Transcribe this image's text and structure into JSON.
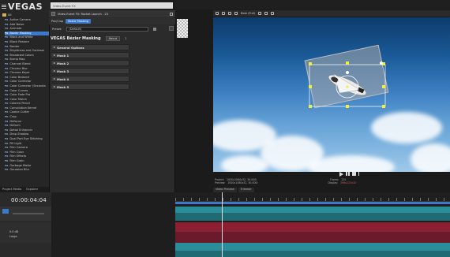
{
  "app": {
    "logo": "VEGAS"
  },
  "fx_list": {
    "items": [
      {
        "tag": "FX",
        "label": "Active Camera"
      },
      {
        "tag": "FX",
        "label": "Add Noise"
      },
      {
        "tag": "FX",
        "label": "Animate"
      },
      {
        "tag": "FX",
        "label": "Bezier Masking"
      },
      {
        "tag": "FX",
        "label": "Black and White"
      },
      {
        "tag": "FX",
        "label": "Black Restore"
      },
      {
        "tag": "FX",
        "label": "Border"
      },
      {
        "tag": "FX",
        "label": "Brightness and Contrast"
      },
      {
        "tag": "FX",
        "label": "Broadcast Colors"
      },
      {
        "tag": "FX",
        "label": "Bump Map"
      },
      {
        "tag": "FX",
        "label": "Channel Blend"
      },
      {
        "tag": "FX",
        "label": "Chroma Blur"
      },
      {
        "tag": "FX",
        "label": "Chroma Keyer"
      },
      {
        "tag": "FX",
        "label": "Color Balance"
      },
      {
        "tag": "FX",
        "label": "Color Corrector"
      },
      {
        "tag": "FX",
        "label": "Color Corrector (Seconda"
      },
      {
        "tag": "FX",
        "label": "Color Curves"
      },
      {
        "tag": "FX",
        "label": "Color Fade Pro"
      },
      {
        "tag": "FX",
        "label": "Color Match"
      },
      {
        "tag": "FX",
        "label": "Colored Pencil"
      },
      {
        "tag": "FX",
        "label": "Convolution Kernel"
      },
      {
        "tag": "FX",
        "label": "Cookie Cutter"
      },
      {
        "tag": "FX",
        "label": "Crop"
      },
      {
        "tag": "FX",
        "label": "Defocus"
      },
      {
        "tag": "FX",
        "label": "Deform"
      },
      {
        "tag": "FX",
        "label": "Detail Enhancer"
      },
      {
        "tag": "FX",
        "label": "Drop Shadow"
      },
      {
        "tag": "FX",
        "label": "Dual Port Eye Stitching"
      },
      {
        "tag": "FX",
        "label": "Fill Light"
      },
      {
        "tag": "FX",
        "label": "Film Camera"
      },
      {
        "tag": "FX",
        "label": "Film Color"
      },
      {
        "tag": "FX",
        "label": "Film Effects"
      },
      {
        "tag": "FX",
        "label": "Film Grain"
      },
      {
        "tag": "FX",
        "label": "Garbage Matte"
      },
      {
        "tag": "FX",
        "label": "Gaussian Blur"
      }
    ],
    "selected_index": 3,
    "root_label": "All"
  },
  "left_tabs": [
    "Project Media",
    "Explorer"
  ],
  "dialog": {
    "window_title": "Video Event FX",
    "topbar_text": "Video Event FX:  Rocket Launch - 23",
    "chain_label": "Pan/Crop",
    "chain_tag": "Bezier Masking",
    "preset_label": "Preset:",
    "preset_value": "(Default)",
    "plugin_title": "VEGAS Bézier Masking",
    "about_label": "About",
    "sections": [
      "General Options",
      "Mask 1",
      "Mask 2",
      "Mask 3",
      "Mask 4",
      "Mask 5"
    ]
  },
  "preview": {
    "quality": "Best (Full)",
    "project_label": "Project:",
    "project_value": "1920x1080x32, 30.000i",
    "preview_label": "Preview:",
    "preview_value": "1920x1080x32, 30.000i",
    "frame_label": "Frame:",
    "frame_value": "124",
    "display_label": "Display:",
    "display_value": "396x223x32",
    "tabs": [
      "Video Preview",
      "Trimmer"
    ]
  },
  "timeline": {
    "timecode": "00:00:04:04",
    "track_label": "Large",
    "level_value": "0.0 dB"
  },
  "colors": {
    "accent": "#3d79c9",
    "video_track": "#2c8c94",
    "audio_track": "#8b2033",
    "panel": "#2b2b2b"
  }
}
